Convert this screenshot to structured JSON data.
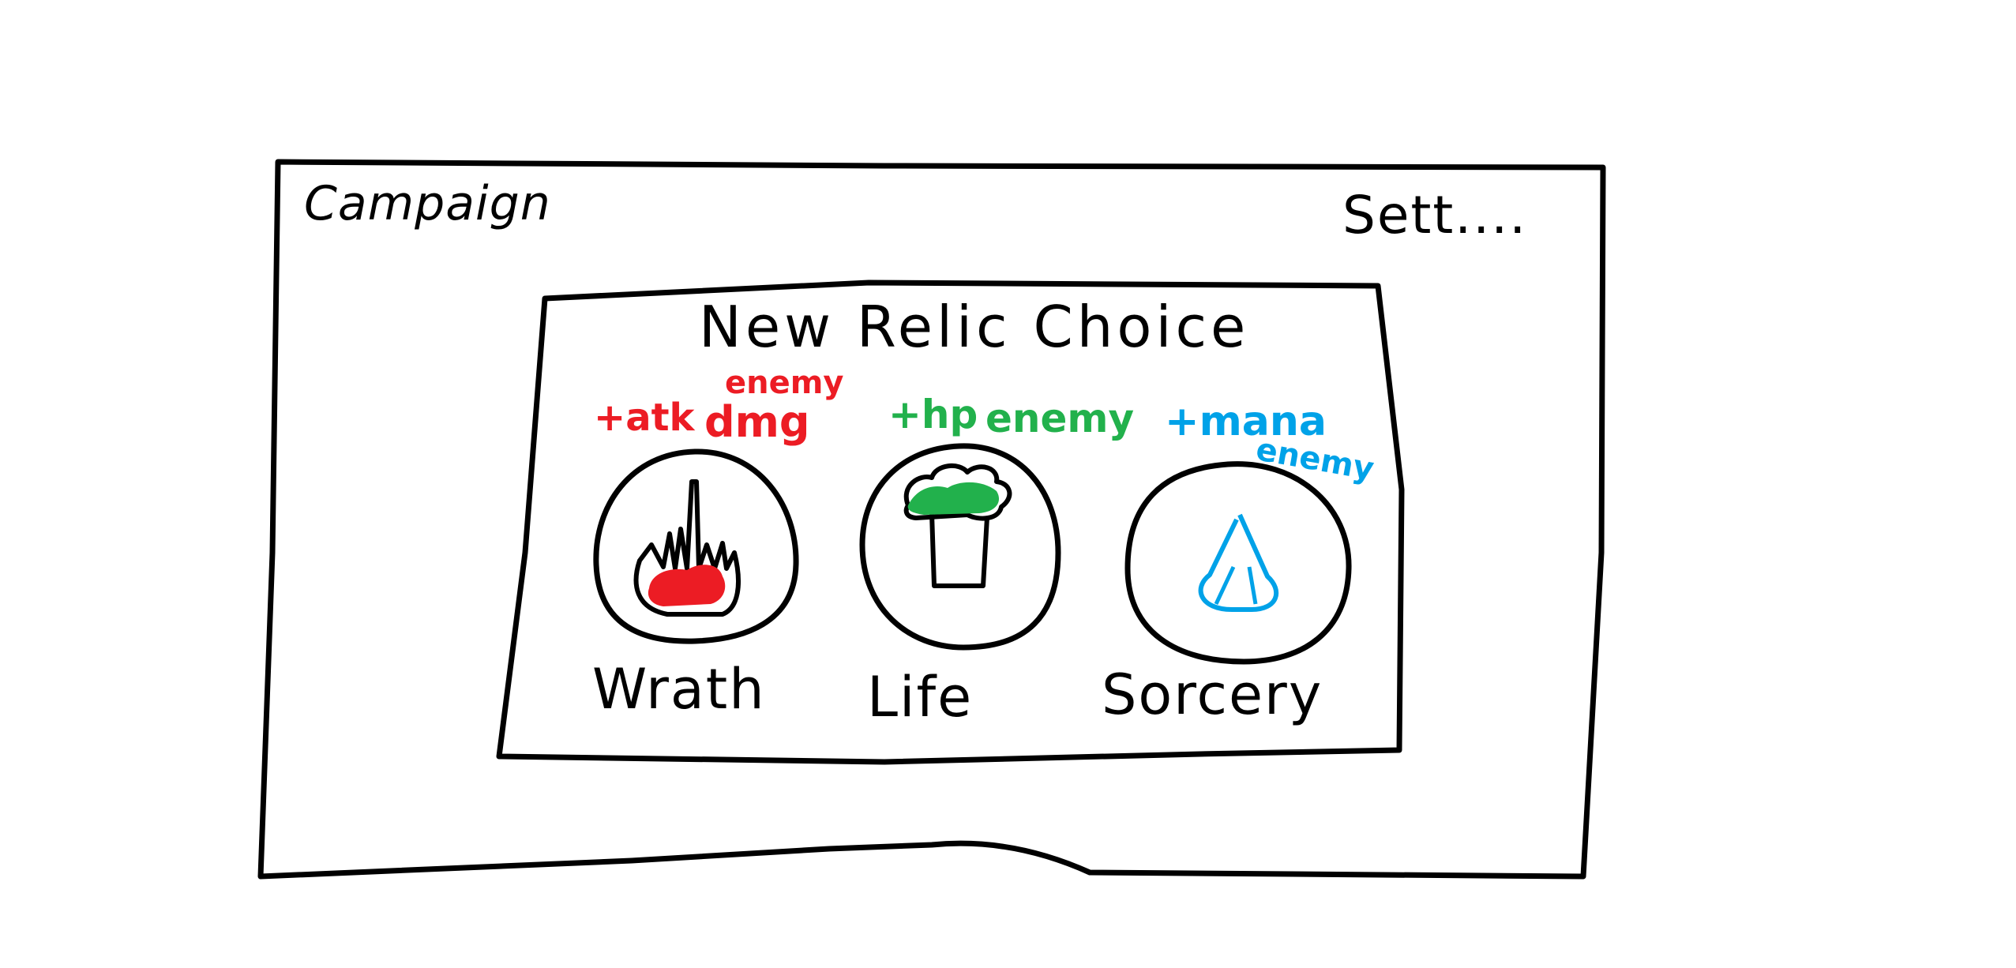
{
  "window": {
    "campaign_label": "Campaign",
    "settings_label": "Sett...."
  },
  "modal": {
    "title": "New Relic Choice"
  },
  "relics": [
    {
      "name": "Wrath",
      "icon": "flame-icon",
      "color": "#ec1c24",
      "bonus_main": "+atk",
      "bonus_target_top": "enemy",
      "bonus_target_bottom": "dmg"
    },
    {
      "name": "Life",
      "icon": "tree-icon",
      "color": "#22b14c",
      "bonus_main": "+hp",
      "bonus_target": "enemy"
    },
    {
      "name": "Sorcery",
      "icon": "wizard-hat-icon",
      "color": "#00a2e8",
      "bonus_main": "+mana",
      "bonus_target": "enemy"
    }
  ]
}
